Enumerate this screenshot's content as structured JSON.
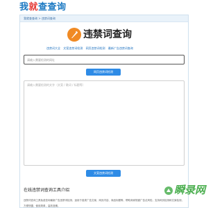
{
  "header": {
    "logo_part1": "我",
    "logo_part2": "就",
    "logo_part3": "查查询"
  },
  "breadcrumb": {
    "home": "我就查查询",
    "separator": " > ",
    "current": "违禁词查询"
  },
  "brand": {
    "title": "违禁词查询",
    "accent_color": "#f08a24"
  },
  "links": [
    "违禁词大全",
    "文案违禁词检测",
    "网页违禁词检测",
    "最新广告违禁词查询"
  ],
  "url_check": {
    "placeholder": "请输入需要检测的网址",
    "button_label": "网页违禁词检测"
  },
  "text_check": {
    "placeholder": "请输入需要检测的文字（文案 / 歌词 / 标题等）",
    "button_label": "文案违禁词检测"
  },
  "intro": {
    "title": "在线违禁词查询工具介绍",
    "text": "违禁词查询工具免费查询最新广告违禁词检测，适用于各类广告文案、网页内容、商品标题等，帮助商家规避广告法风险，支持网页检测和文案检测，方便快捷，使用简单，高效准确。"
  },
  "watermark": {
    "text": "瞬录网"
  },
  "colors": {
    "primary": "#2e8be6",
    "logo_blue": "#1a78c2",
    "logo_red": "#e53935"
  }
}
